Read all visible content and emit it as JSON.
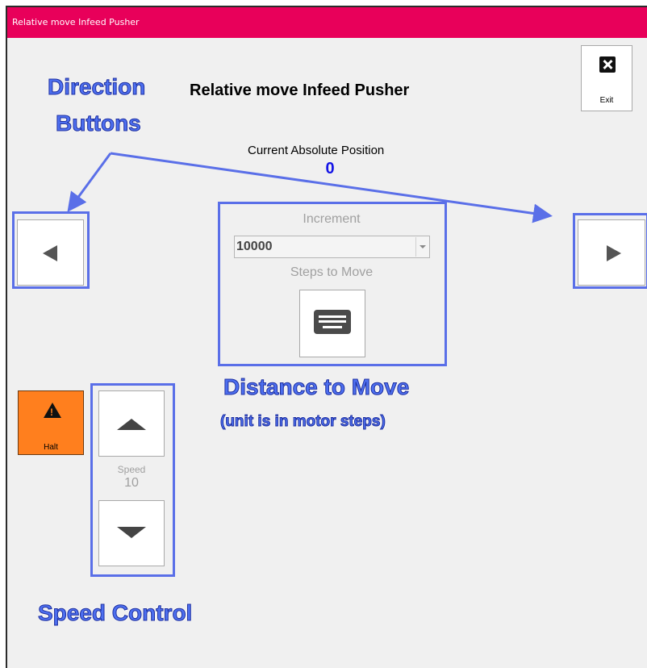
{
  "window": {
    "title": "Relative move Infeed Pusher"
  },
  "header": {
    "title": "Relative move Infeed Pusher",
    "exit_label": "Exit"
  },
  "position": {
    "caption": "Current Absolute Position",
    "value": "0"
  },
  "increment": {
    "label": "Increment",
    "selected": "10000",
    "steps_label": "Steps to Move"
  },
  "speed": {
    "label": "Speed",
    "value": "10"
  },
  "halt": {
    "label": "Halt"
  },
  "annotations": {
    "direction_line1": "Direction",
    "direction_line2": "Buttons",
    "distance_title": "Distance to Move",
    "distance_sub": "(unit is in motor steps)",
    "speed_title": "Speed Control"
  },
  "icons": {
    "exit": "close-icon",
    "left": "arrow-left-icon",
    "right": "arrow-right-icon",
    "keyboard": "keyboard-icon",
    "halt": "warning-icon",
    "speed_up": "arrow-up-icon",
    "speed_down": "arrow-down-icon"
  },
  "colors": {
    "titlebar": "#e8005a",
    "highlight": "#5a6fe8",
    "position_value": "#1414e6",
    "halt": "#ff7f1e"
  }
}
